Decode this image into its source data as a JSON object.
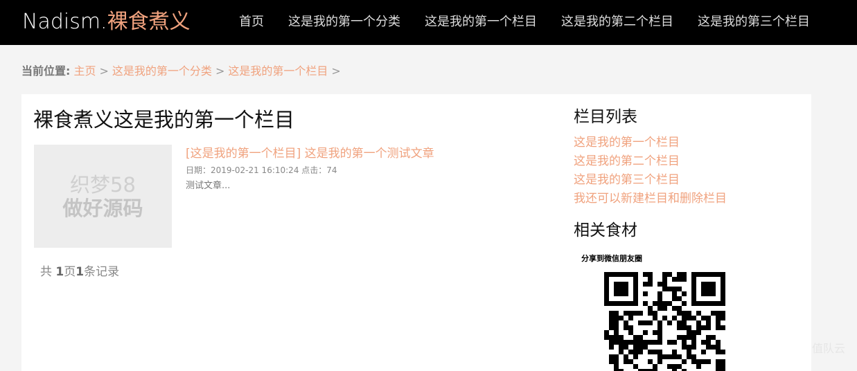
{
  "header": {
    "logo_latin": "Nadism.",
    "logo_cn": "裸食煮义",
    "nav": [
      {
        "label": "首页"
      },
      {
        "label": "这是我的第一个分类"
      },
      {
        "label": "这是我的第一个栏目"
      },
      {
        "label": "这是我的第二个栏目"
      },
      {
        "label": "这是我的第三个栏目"
      }
    ]
  },
  "breadcrumb": {
    "prefix": "当前位置:",
    "items": [
      "主页",
      "这是我的第一个分类",
      "这是我的第一个栏目"
    ],
    "separator": ">"
  },
  "main": {
    "title": "裸食煮义这是我的第一个栏目",
    "articles": [
      {
        "thumb_line1": "织梦58",
        "thumb_line2": "做好源码",
        "category_tag": "[这是我的第一个栏目]",
        "title": "这是我的第一个测试文章",
        "meta": "日期：2019-02-21 16:10:24 点击：74",
        "desc": "测试文章..."
      }
    ],
    "pager": {
      "pre": "共 ",
      "pages": "1",
      "mid": "页",
      "records": "1",
      "post": "条记录"
    }
  },
  "sidebar": {
    "columns_heading": "栏目列表",
    "columns": [
      "这是我的第一个栏目",
      "这是我的第二个栏目",
      "这是我的第三个栏目",
      "我还可以新建栏目和删除栏目"
    ],
    "related_heading": "相关食材",
    "share_label": "分享到微信朋友圈"
  },
  "watermark": "值队云",
  "colors": {
    "accent": "#f0a27e",
    "header_bg": "#000000",
    "page_bg": "#f4f4f4"
  }
}
